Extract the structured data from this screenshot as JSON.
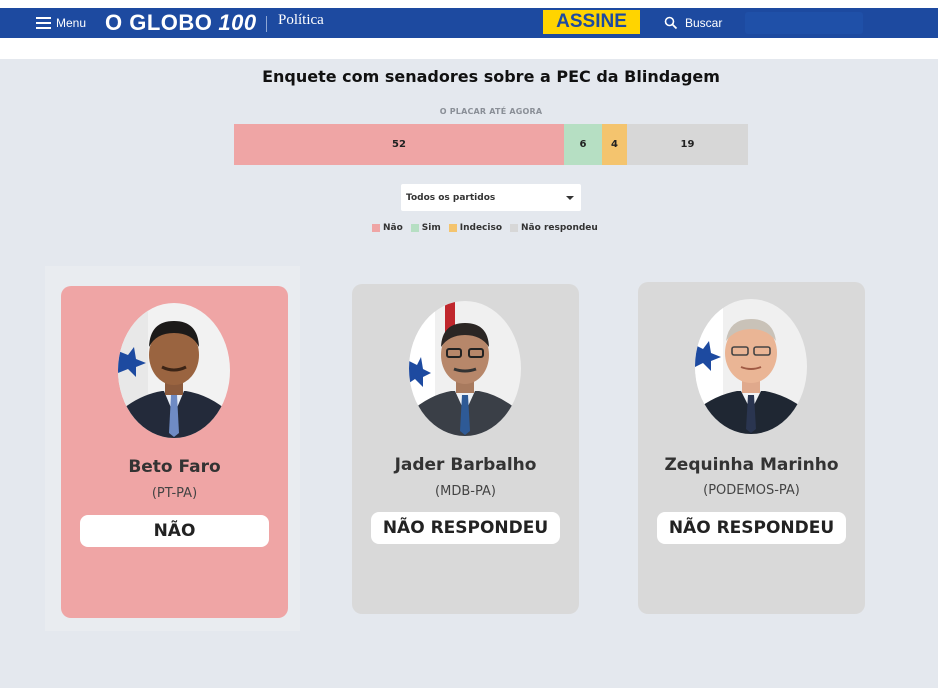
{
  "header": {
    "menu_label": "Menu",
    "logo_text": "O GLOBO",
    "logo_badge": "100",
    "section_label": "Política",
    "subscribe_label": "ASSINE",
    "search_label": "Buscar",
    "colors": {
      "bar": "#1d4aa0",
      "subscribe": "#ffd400"
    }
  },
  "poll": {
    "title": "Enquete com senadores sobre a PEC da Blindagem",
    "scoreboard_label": "O PLACAR ATÉ AGORA",
    "scoreboard": [
      {
        "key": "nao",
        "value": "52",
        "count": 52,
        "color": "#efa5a5"
      },
      {
        "key": "sim",
        "value": "6",
        "count": 6,
        "color": "#b6dfc3"
      },
      {
        "key": "indeciso",
        "value": "4",
        "count": 4,
        "color": "#f4c46e"
      },
      {
        "key": "nao_respondeu",
        "value": "19",
        "count": 19,
        "color": "#d7d7d7"
      }
    ],
    "party_filter": {
      "selected": "Todos os partidos"
    },
    "legend": [
      {
        "label": "Não",
        "color": "#efa5a5"
      },
      {
        "label": "Sim",
        "color": "#b6dfc3"
      },
      {
        "label": "Indeciso",
        "color": "#f4c46e"
      },
      {
        "label": "Não respondeu",
        "color": "#d7d7d7"
      }
    ]
  },
  "senators": [
    {
      "name": "Beto Faro",
      "party": "(PT-PA)",
      "vote": "NÃO",
      "card_color": "#efa5a5"
    },
    {
      "name": "Jader Barbalho",
      "party": "(MDB-PA)",
      "vote": "NÃO RESPONDEU",
      "card_color": "#d9d9d9"
    },
    {
      "name": "Zequinha Marinho",
      "party": "(PODEMOS-PA)",
      "vote": "NÃO RESPONDEU",
      "card_color": "#d9d9d9"
    }
  ]
}
